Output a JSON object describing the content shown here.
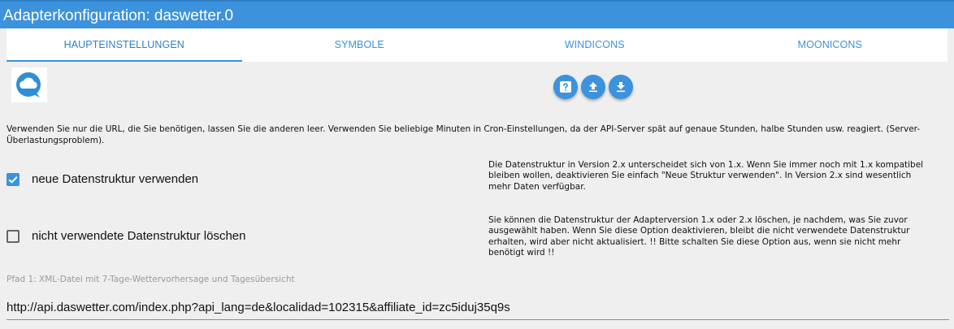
{
  "window": {
    "title": "Adapterkonfiguration: daswetter.0"
  },
  "tabs": [
    {
      "label": "HAUPTEINSTELLUNGEN",
      "active": true
    },
    {
      "label": "SYMBOLE",
      "active": false
    },
    {
      "label": "WINDICONS",
      "active": false
    },
    {
      "label": "MOONICONS",
      "active": false
    }
  ],
  "actions": {
    "help_icon": "help-icon",
    "upload_icon": "upload-icon",
    "download_icon": "download-icon"
  },
  "info_text": "Verwenden Sie nur die URL, die Sie benötigen, lassen Sie die anderen leer. Verwenden Sie beliebige Minuten in Cron-Einstellungen, da der API-Server spät auf genaue Stunden, halbe Stunden usw. reagiert. (Server-Überlastungsproblem).",
  "options": [
    {
      "label": "neue Datenstruktur verwenden",
      "checked": true,
      "help": "Die Datenstruktur in Version 2.x unterscheidet sich von 1.x. Wenn Sie immer noch mit 1.x kompatibel bleiben wollen, deaktivieren Sie einfach \"Neue Struktur verwenden\". In Version 2.x sind wesentlich mehr Daten verfügbar."
    },
    {
      "label": "nicht verwendete Datenstruktur löschen",
      "checked": false,
      "help": "Sie können die Datenstruktur der Adapterversion 1.x oder 2.x löschen, je nachdem, was Sie zuvor ausgewählt haben. Wenn Sie diese Option deaktivieren, bleibt die nicht verwendete Datenstruktur erhalten, wird aber nicht aktualisiert. !! Bitte schalten Sie diese Option aus, wenn sie nicht mehr benötigt wird !!"
    }
  ],
  "path1": {
    "label": "Pfad 1: XML-Datei mit 7-Tage-Wettervorhersage und Tagesübersicht",
    "value": "http://api.daswetter.com/index.php?api_lang=de&localidad=102315&affiliate_id=zc5iduj35q9s"
  },
  "colors": {
    "accent": "#3c92dc",
    "background": "#efefef"
  }
}
